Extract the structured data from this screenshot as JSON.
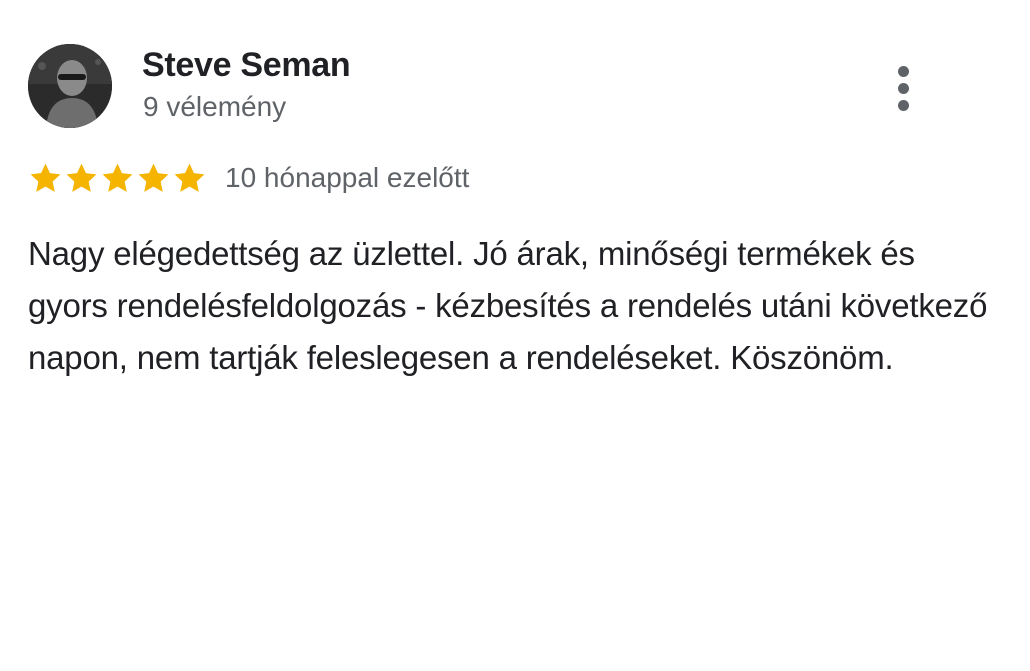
{
  "review": {
    "author": {
      "name": "Steve Seman",
      "review_count": "9 vélemény",
      "avatar_icon": "profile-photo"
    },
    "rating": {
      "stars": 5,
      "max_stars": 5,
      "star_color": "#F5B400"
    },
    "time_ago": "10 hónappal ezelőtt",
    "text": "Nagy elégedettség az üzlettel. Jó árak, minőségi termékek és gyors rendelésfeldolgozás - kézbesítés a rendelés utáni következő napon, nem tartják feleslegesen a rendeléseket. Köszönöm.",
    "menu_icon": "more-vert-icon"
  }
}
